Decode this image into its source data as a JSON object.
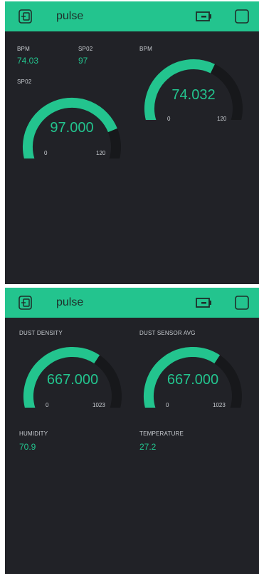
{
  "screen1": {
    "title": "pulse",
    "icons": [
      "device-frame-icon",
      "battery-icon",
      "square-icon"
    ],
    "bpm_label": "BPM",
    "bpm_value": "74.03",
    "spo2_label": "SP02",
    "spo2_value": "97",
    "gauge_spo2": {
      "label": "SP02",
      "value": "97.000",
      "min": "0",
      "max": "120",
      "level": 0.808
    },
    "gauge_bpm": {
      "label": "BPM",
      "value": "74.032",
      "min": "0",
      "max": "120",
      "level": 0.617
    }
  },
  "screen2": {
    "title": "pulse",
    "icons": [
      "device-frame-icon",
      "battery-icon",
      "square-icon"
    ],
    "gauge_dust": {
      "label": "DUST DENSITY",
      "value": "667.000",
      "min": "0",
      "max": "1023",
      "level": 0.652
    },
    "gauge_dust_avg": {
      "label": "DUST SENSOR AVG",
      "value": "667.000",
      "min": "0",
      "max": "1023",
      "level": 0.652
    },
    "humidity_label": "HUMIDITY",
    "humidity_value": "70.9",
    "temperature_label": "TEMPERATURE",
    "temperature_value": "27.2"
  },
  "colors": {
    "accent": "#23c48e",
    "background": "#212227",
    "track": "#17181b",
    "label": "#c9cdd2"
  }
}
